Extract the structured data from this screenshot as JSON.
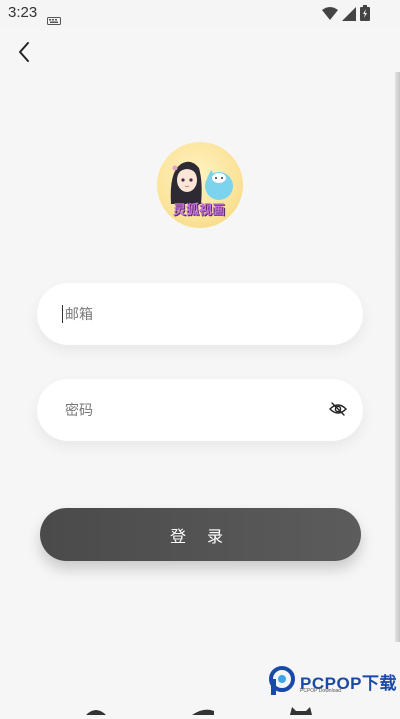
{
  "status_bar": {
    "time": "3:23",
    "icons": [
      "keyboard-icon",
      "wifi-icon",
      "signal-icon",
      "battery-icon"
    ]
  },
  "nav": {
    "back_icon": "chevron-left-icon"
  },
  "avatar": {
    "logo_text": "灵狐视画"
  },
  "form": {
    "email_placeholder": "邮箱",
    "email_value": "",
    "password_placeholder": "密码",
    "password_value": "",
    "visibility_icon": "eye-off-icon"
  },
  "actions": {
    "login_label": "登 录"
  },
  "watermark": {
    "text": "PCPOP下载",
    "subtext": "PCPOP Download"
  },
  "colors": {
    "background": "#f6f6f6",
    "button": "#535353",
    "input_bg": "#ffffff",
    "watermark_blue": "#1a4aa8"
  }
}
